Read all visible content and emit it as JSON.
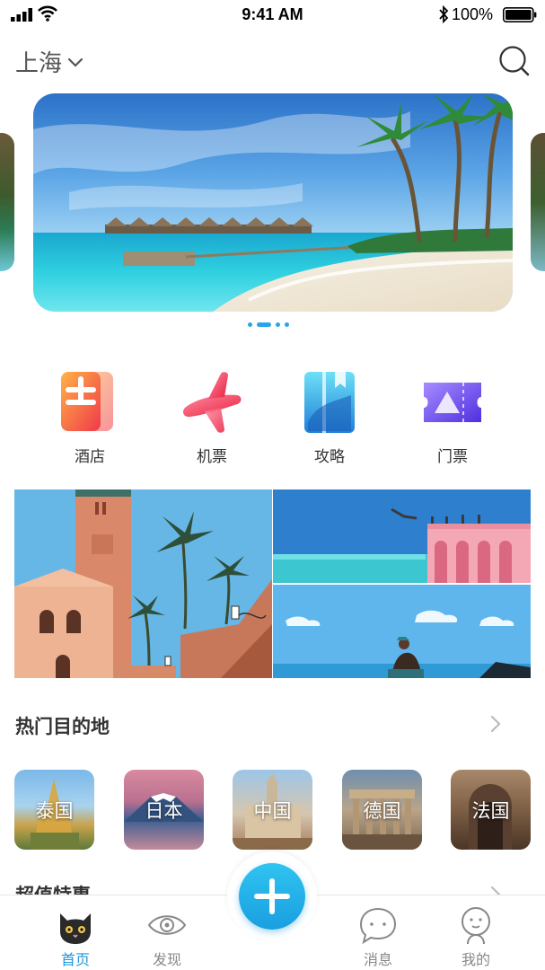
{
  "status_bar": {
    "time": "9:41 AM",
    "battery": "100%"
  },
  "header": {
    "city": "上海",
    "icons": {
      "city_dropdown": "chevron-down-icon",
      "search": "search-icon"
    }
  },
  "banner": {
    "slide_count": 4,
    "active_slide": 2,
    "icon": "beach-resort-photo"
  },
  "quick_menu": [
    {
      "label": "酒店",
      "icon": "hotel-icon",
      "color": "#f25a47"
    },
    {
      "label": "机票",
      "icon": "airplane-icon",
      "color": "#f0405a"
    },
    {
      "label": "攻略",
      "icon": "guide-book-icon",
      "color": "#3ab8ea"
    },
    {
      "label": "门票",
      "icon": "ticket-icon",
      "color": "#6a4ef0"
    }
  ],
  "hot_destinations": {
    "title": "热门目的地",
    "items": [
      {
        "label": "泰国"
      },
      {
        "label": "日本"
      },
      {
        "label": "中国"
      },
      {
        "label": "德国"
      },
      {
        "label": "法国"
      }
    ]
  },
  "deals": {
    "title": "超值特惠"
  },
  "tabbar": {
    "items": [
      {
        "label": "首页",
        "icon": "cat-face-icon",
        "active": true
      },
      {
        "label": "发现",
        "icon": "eye-icon",
        "active": false
      },
      {
        "label": "消息",
        "icon": "chat-bubble-icon",
        "active": false
      },
      {
        "label": "我的",
        "icon": "user-face-icon",
        "active": false
      }
    ],
    "fab_icon": "plus-icon"
  },
  "colors": {
    "accent": "#2196d9",
    "fab": "#1fb0ea"
  }
}
